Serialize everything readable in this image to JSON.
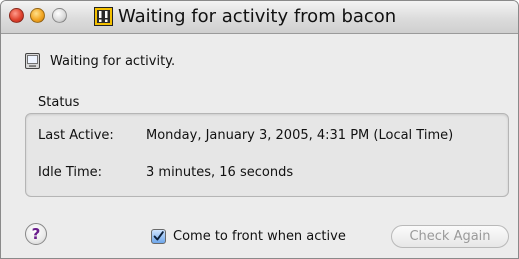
{
  "window": {
    "title": "Waiting for activity from bacon",
    "traffic_lights": {
      "close": "close-button",
      "minimize": "minimize-button",
      "zoom": "zoom-button"
    }
  },
  "status_line": {
    "icon": "monitor-icon",
    "text": "Waiting for activity."
  },
  "status_group": {
    "label": "Status",
    "rows": [
      {
        "label": "Last Active:",
        "value": "Monday, January 3, 2005, 4:31 PM (Local Time)"
      },
      {
        "label": "Idle Time:",
        "value": "3 minutes, 16 seconds"
      }
    ]
  },
  "footer": {
    "help_label": "?",
    "checkbox": {
      "label": "Come to front when active",
      "checked": true
    },
    "check_again_label": "Check Again",
    "check_again_enabled": false
  },
  "colors": {
    "close": "#e0442f",
    "minimize": "#f2a623",
    "help_mark": "#6a1d8c",
    "checkbox_fill": "#6da6ea"
  }
}
